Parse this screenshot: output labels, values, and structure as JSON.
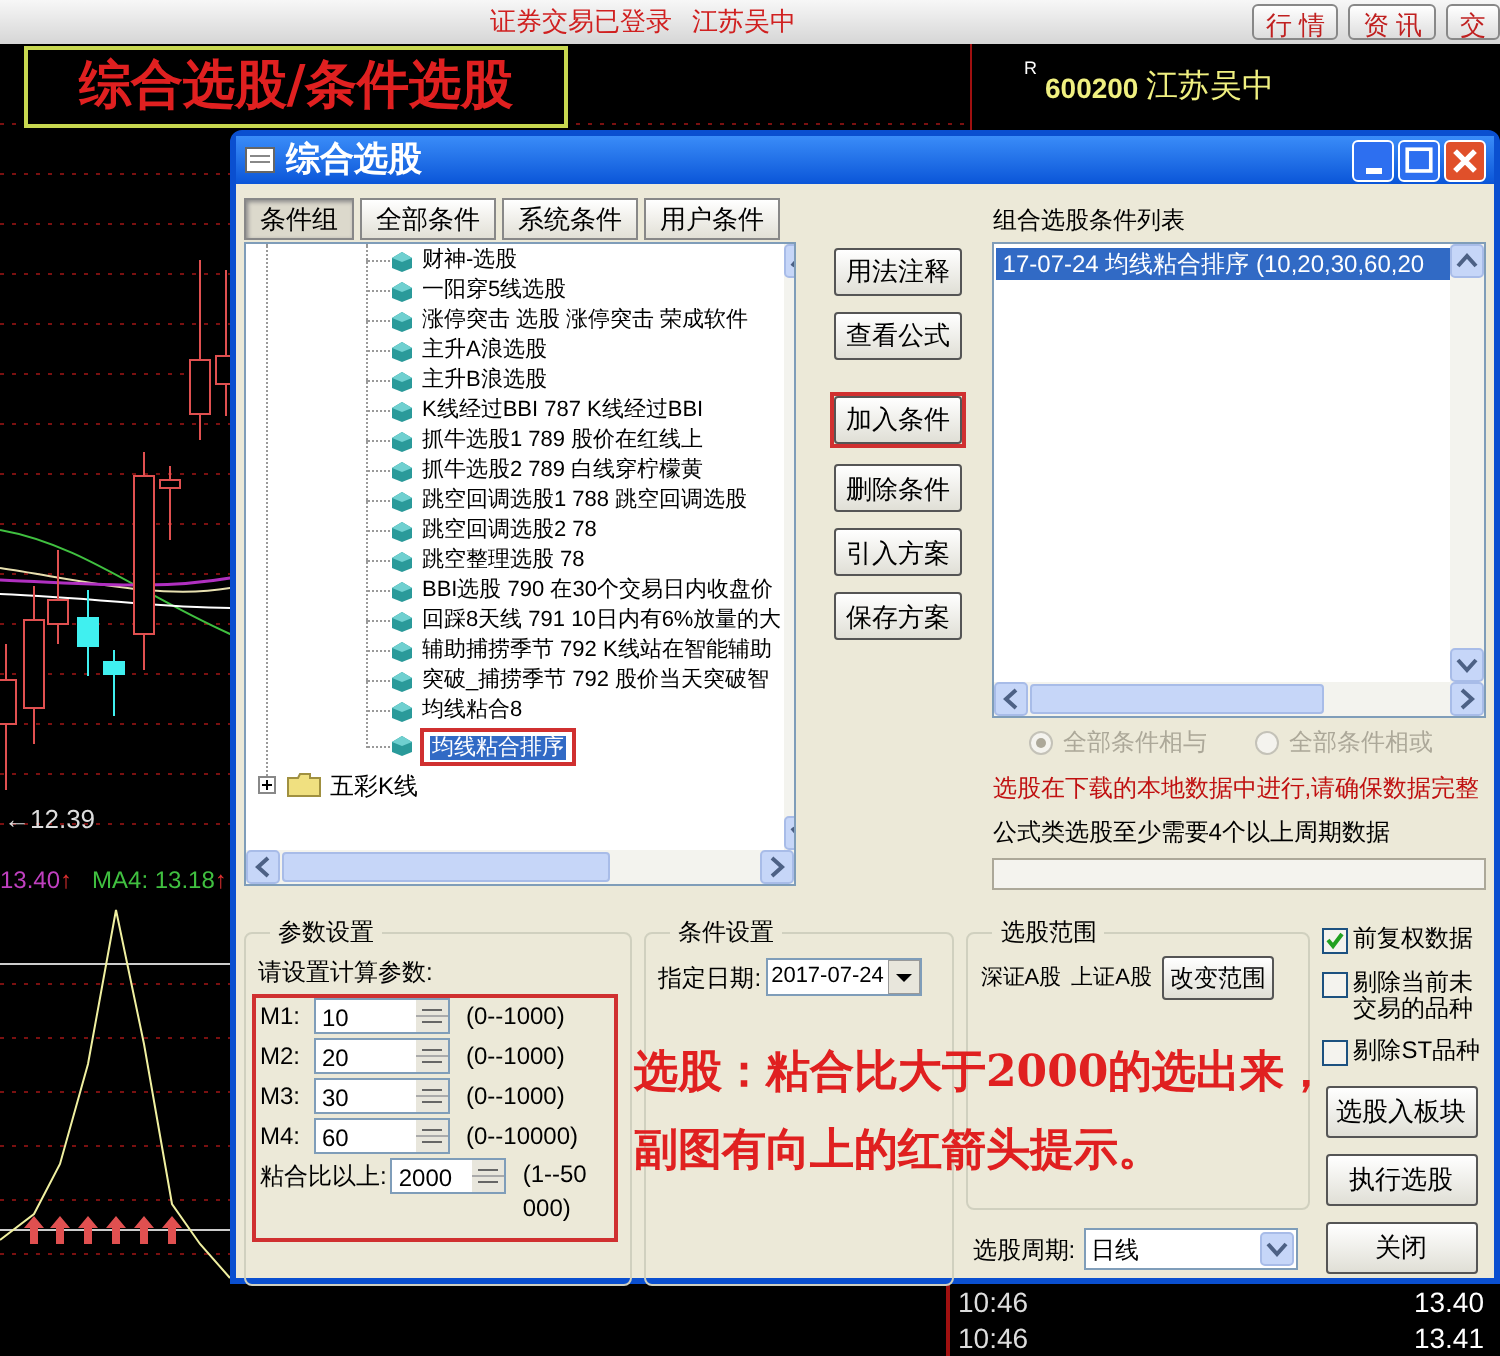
{
  "top_bar": {
    "status": "证券交易已登录",
    "stock": "江苏吴中",
    "buttons": [
      "行 情",
      "资 讯",
      "交"
    ]
  },
  "quote_panel": {
    "marker": "R",
    "code": "600200",
    "name": "江苏吴中"
  },
  "chart": {
    "low_label": "←12.39",
    "indicator_labels": [
      {
        "text": "13.40",
        "arrow": "↑",
        "color": "#c040c0"
      },
      {
        "text": "MA4: 13.18",
        "arrow": "↑",
        "color": "#40c040"
      }
    ]
  },
  "ticks": [
    {
      "time": "10:46",
      "price": "13.40"
    },
    {
      "time": "10:46",
      "price": "13.41"
    }
  ],
  "annotation_title": "综合选股/条件选股",
  "dialog": {
    "title": "综合选股",
    "tabs": [
      {
        "label": "条件组",
        "selected": true
      },
      {
        "label": "全部条件",
        "selected": false
      },
      {
        "label": "系统条件",
        "selected": false
      },
      {
        "label": "用户条件",
        "selected": false
      }
    ],
    "tree": [
      {
        "kind": "leaf",
        "label": "财神-选股",
        "selected": false,
        "annotated": false
      },
      {
        "kind": "leaf",
        "label": "一阳穿5线选股",
        "selected": false,
        "annotated": false
      },
      {
        "kind": "leaf",
        "label": "涨停突击 选股 涨停突击 荣成软件",
        "selected": false,
        "annotated": false
      },
      {
        "kind": "leaf",
        "label": "主升A浪选股",
        "selected": false,
        "annotated": false
      },
      {
        "kind": "leaf",
        "label": "主升B浪选股",
        "selected": false,
        "annotated": false
      },
      {
        "kind": "leaf",
        "label": "K线经过BBI 787 K线经过BBI",
        "selected": false,
        "annotated": false
      },
      {
        "kind": "leaf",
        "label": "抓牛选股1 789 股价在红线上",
        "selected": false,
        "annotated": false
      },
      {
        "kind": "leaf",
        "label": "抓牛选股2 789 白线穿柠檬黄",
        "selected": false,
        "annotated": false
      },
      {
        "kind": "leaf",
        "label": "跳空回调选股1 788 跳空回调选股",
        "selected": false,
        "annotated": false
      },
      {
        "kind": "leaf",
        "label": "跳空回调选股2 78",
        "selected": false,
        "annotated": false
      },
      {
        "kind": "leaf",
        "label": "跳空整理选股 78",
        "selected": false,
        "annotated": false
      },
      {
        "kind": "leaf",
        "label": "BBI选股 790 在30个交易日内收盘价",
        "selected": false,
        "annotated": false
      },
      {
        "kind": "leaf",
        "label": "回踩8天线 791 10日内有6%放量的大",
        "selected": false,
        "annotated": false
      },
      {
        "kind": "leaf",
        "label": "辅助捕捞季节 792 K线站在智能辅助",
        "selected": false,
        "annotated": false
      },
      {
        "kind": "leaf",
        "label": "突破_捕捞季节 792 股价当天突破智",
        "selected": false,
        "annotated": false
      },
      {
        "kind": "leaf",
        "label": "均线粘合8",
        "selected": false,
        "annotated": false
      },
      {
        "kind": "leaf",
        "label": "均线粘合排序",
        "selected": true,
        "annotated": true
      },
      {
        "kind": "folder",
        "label": "五彩K线",
        "expanded": false
      }
    ],
    "buttons": [
      {
        "label": "用法注释",
        "annotated": false
      },
      {
        "label": "查看公式",
        "annotated": false
      },
      {
        "label": "加入条件",
        "annotated": true
      },
      {
        "label": "删除条件",
        "annotated": false
      },
      {
        "label": "引入方案",
        "annotated": false
      },
      {
        "label": "保存方案",
        "annotated": false
      }
    ],
    "list_title": "组合选股条件列表",
    "list": [
      {
        "text": "17-07-24 均线粘合排序 (10,20,30,60,20",
        "selected": true
      }
    ],
    "radios": [
      {
        "label": "全部条件相与",
        "selected": true,
        "disabled": true
      },
      {
        "label": "全部条件相或",
        "selected": false,
        "disabled": true
      }
    ],
    "warning": "选股在下载的本地数据中进行,请确保数据完整",
    "note": "公式类选股至少需要4个以上周期数据",
    "params": {
      "title": "参数设置",
      "prompt": "请设置计算参数:",
      "annotated": true,
      "rows": [
        {
          "label": "M1:",
          "value": "10",
          "range": "(0--1000)"
        },
        {
          "label": "M2:",
          "value": "20",
          "range": "(0--1000)"
        },
        {
          "label": "M3:",
          "value": "30",
          "range": "(0--1000)"
        },
        {
          "label": "M4:",
          "value": "60",
          "range": "(0--10000)"
        },
        {
          "label": "粘合比以上:",
          "value": "2000",
          "range": "(1--50000)"
        }
      ]
    },
    "condition": {
      "title": "条件设置",
      "date_label": "指定日期:",
      "date": "2017-07-24"
    },
    "range": {
      "title": "选股范围",
      "markets": [
        "深证A股",
        "上证A股"
      ],
      "button": "改变范围"
    },
    "checkboxes": [
      {
        "label": "前复权数据",
        "checked": true
      },
      {
        "label": "剔除当前未交易的品种",
        "checked": false
      },
      {
        "label": "剔除ST品种",
        "checked": false
      }
    ],
    "side_buttons": [
      "选股入板块",
      "执行选股",
      "关闭"
    ],
    "period": {
      "label": "选股周期:",
      "value": "日线"
    }
  },
  "annotation_caption": [
    "选股：粘合比大于2000的选出来，",
    "副图有向上的红箭头提示。"
  ]
}
